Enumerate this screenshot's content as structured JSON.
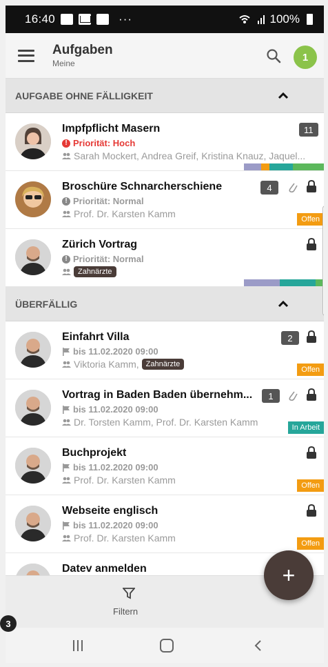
{
  "status_bar": {
    "time": "16:40",
    "more": "···",
    "battery": "100%"
  },
  "app_bar": {
    "title": "Aufgaben",
    "subtitle": "Meine",
    "badge_count": "1"
  },
  "colors": {
    "offen": "#f39c12",
    "in_arbeit": "#26a69a",
    "fab": "#4a3c38",
    "badge": "#8bc34a",
    "priority_high": "#e53935"
  },
  "sections": [
    {
      "title": "AUFGABE OHNE FÄLLIGKEIT",
      "items": [
        {
          "title": "Impfpflicht Masern",
          "line2": "Priorität: Hoch",
          "line3": "Sarah Mockert, Andrea Greif, Kristina Knauz, Jaquel...",
          "count": "11"
        },
        {
          "title": "Broschüre Schnarcherschiene",
          "line2": "Priorität: Normal",
          "line3": "Prof. Dr. Karsten Kamm",
          "count": "4",
          "status": "Offen"
        },
        {
          "title": "Zürich Vortrag",
          "line2": "Priorität: Normal",
          "tag": "Zahnärzte"
        }
      ]
    },
    {
      "title": "ÜBERFÄLLIG",
      "items": [
        {
          "title": "Einfahrt Villa",
          "line2": "bis 11.02.2020 09:00",
          "line3": "Viktoria Kamm,",
          "tag": "Zahnärzte",
          "count": "2",
          "status": "Offen"
        },
        {
          "title": "Vortrag in Baden Baden übernehm...",
          "line2": "bis 11.02.2020 09:00",
          "line3": "Dr. Torsten Kamm, Prof. Dr. Karsten Kamm",
          "count": "1",
          "status": "In Arbeit"
        },
        {
          "title": "Buchprojekt",
          "line2": "bis 11.02.2020 09:00",
          "line3": "Prof. Dr. Karsten Kamm",
          "status": "Offen"
        },
        {
          "title": "Webseite englisch",
          "line2": "bis 11.02.2020 09:00",
          "line3": "Prof. Dr. Karsten Kamm",
          "status": "Offen"
        },
        {
          "title": "Datev anmelden"
        }
      ]
    }
  ],
  "filter_label": "Filtern",
  "fab_label": "+",
  "step_badge": "3"
}
